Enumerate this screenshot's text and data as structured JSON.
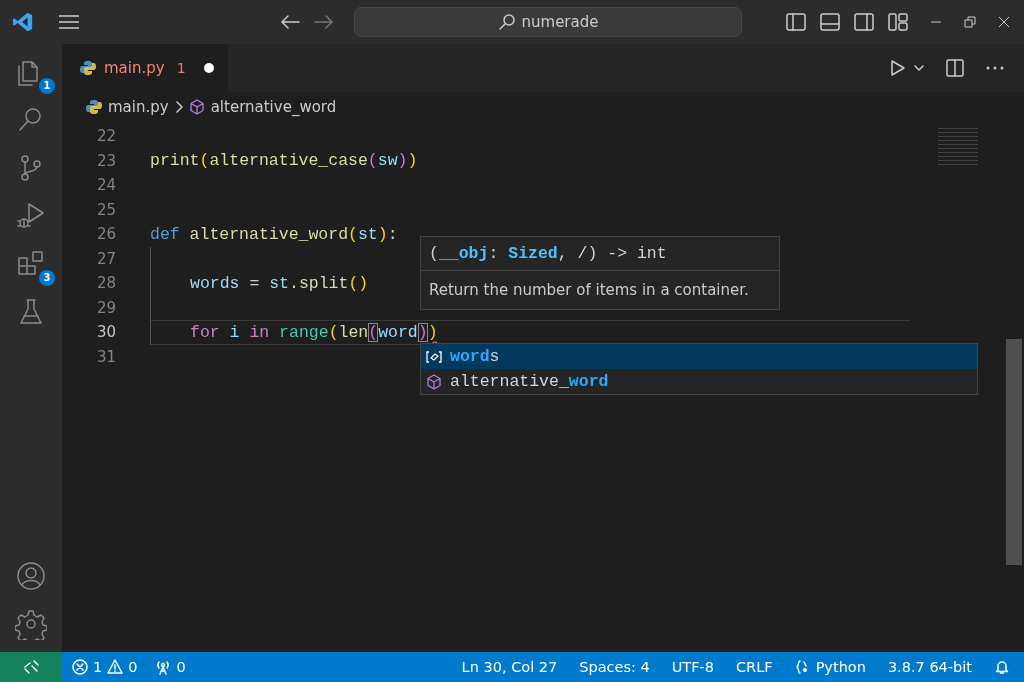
{
  "title_bar": {
    "search": "numerade"
  },
  "activity_bar": [
    {
      "kind": "explorer",
      "badge": "1"
    },
    {
      "kind": "search"
    },
    {
      "kind": "source-control"
    },
    {
      "kind": "run-debug"
    },
    {
      "kind": "extensions",
      "badge": "3"
    },
    {
      "kind": "testing"
    }
  ],
  "activity_bar_bottom": [
    {
      "kind": "account"
    },
    {
      "kind": "settings"
    }
  ],
  "tabs": [
    {
      "label": "main.py",
      "problems": "1",
      "modified": true,
      "selected": true
    }
  ],
  "breadcrumb": [
    {
      "kind": "file",
      "label": "main.py"
    },
    {
      "kind": "function",
      "label": "alternative_word"
    }
  ],
  "editor": {
    "lines": [
      {
        "number": "22",
        "current": false,
        "guide": false
      },
      {
        "number": "23",
        "current": false,
        "guide": false,
        "tokens": [
          {
            "text": "print",
            "kind": "function"
          },
          {
            "text": "(",
            "kind": "paren1"
          },
          {
            "text": "alternative_case",
            "kind": "function"
          },
          {
            "text": "(",
            "kind": "paren2"
          },
          {
            "text": "sw",
            "kind": "variable"
          },
          {
            "text": ")",
            "kind": "paren2"
          },
          {
            "text": ")",
            "kind": "paren1"
          }
        ]
      },
      {
        "number": "24",
        "current": false,
        "guide": false
      },
      {
        "number": "25",
        "current": false,
        "guide": false
      },
      {
        "number": "26",
        "current": false,
        "guide": false,
        "tokens": [
          {
            "text": "def",
            "kind": "keyword"
          },
          {
            "text": "alternative_word",
            "kind": "function",
            "space": true
          },
          {
            "text": "(",
            "kind": "paren1"
          },
          {
            "text": "st",
            "kind": "variable"
          },
          {
            "text": ")",
            "kind": "paren1"
          },
          {
            "text": ":",
            "kind": "plain"
          }
        ]
      },
      {
        "number": "27",
        "current": false,
        "guide": true
      },
      {
        "number": "28",
        "current": false,
        "guide": true,
        "tokens": [
          {
            "text": "words",
            "kind": "variable"
          },
          {
            "text": "=",
            "kind": "plain",
            "space": true
          },
          {
            "text": "st",
            "kind": "variable",
            "space": true
          },
          {
            "text": ".split",
            "kind": "function"
          },
          {
            "text": "()",
            "kind": "paren1"
          }
        ]
      },
      {
        "number": "29",
        "current": false,
        "guide": true
      },
      {
        "number": "30",
        "current": true,
        "guide": true,
        "tokens": [
          {
            "text": "for",
            "kind": "control"
          },
          {
            "text": "i",
            "kind": "variable",
            "space": true
          },
          {
            "text": "in",
            "kind": "control",
            "space": true
          },
          {
            "text": "range",
            "kind": "builtin",
            "space": true
          },
          {
            "text": "(",
            "kind": "paren1"
          },
          {
            "text": "len",
            "kind": "function"
          },
          {
            "text": "(",
            "kind": "paren2",
            "matched": true
          },
          {
            "text": "word",
            "kind": "variable"
          },
          {
            "text": ")",
            "kind": "paren2",
            "matched": true
          },
          {
            "text": ")",
            "kind": "paren1",
            "error": true
          }
        ]
      },
      {
        "number": "31",
        "current": false,
        "guide": false
      }
    ]
  },
  "hover": {
    "signature": [
      {
        "text": "(",
        "kind": "plain"
      },
      {
        "text": "__obj",
        "kind": "param"
      },
      {
        "text": ": ",
        "kind": "plain"
      },
      {
        "text": "Sized",
        "kind": "param"
      },
      {
        "text": ", /) -> int",
        "kind": "plain"
      }
    ],
    "doc": "Return the number of items in a container."
  },
  "suggestions": [
    {
      "kind": "variable",
      "selected": true,
      "parts": [
        {
          "text": "word",
          "highlight": true
        },
        {
          "text": "s",
          "highlight": false
        }
      ]
    },
    {
      "kind": "function",
      "selected": false,
      "parts": [
        {
          "text": "alternative_",
          "highlight": false
        },
        {
          "text": "word",
          "highlight": true
        }
      ]
    }
  ],
  "status_bar": {
    "errors": "1",
    "warnings": "0",
    "ports": "0",
    "right": [
      {
        "kind": "text",
        "text": "Ln 30, Col 27"
      },
      {
        "kind": "text",
        "text": "Spaces: 4"
      },
      {
        "kind": "text",
        "text": "UTF-8"
      },
      {
        "kind": "text",
        "text": "CRLF"
      },
      {
        "kind": "language",
        "text": "Python"
      },
      {
        "kind": "text",
        "text": "3.8.7 64-bit"
      }
    ]
  }
}
